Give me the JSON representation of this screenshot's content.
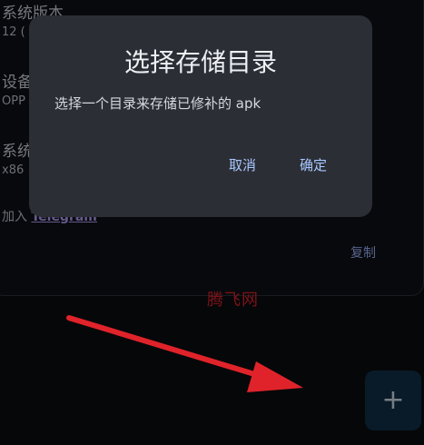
{
  "background": {
    "items": [
      {
        "label": "系统版本",
        "value": "12 ("
      },
      {
        "label": "设备",
        "value": "OPP"
      },
      {
        "label": "系统",
        "value": "x86"
      }
    ],
    "telegram_prefix": "加入",
    "telegram_link": "Telegram",
    "copy_label": "复制"
  },
  "watermark": "腾飞网",
  "fab": {
    "icon": "plus-icon",
    "glyph": "+"
  },
  "dialog": {
    "title": "选择存储目录",
    "message": "选择一个目录来存储已修补的 apk",
    "cancel_label": "取消",
    "ok_label": "确定"
  },
  "colors": {
    "background": "#0b0d12",
    "dialog": "#2b2e35",
    "accent": "#a9c7ff",
    "arrow": "#e0232a",
    "fab": "#12324b"
  }
}
